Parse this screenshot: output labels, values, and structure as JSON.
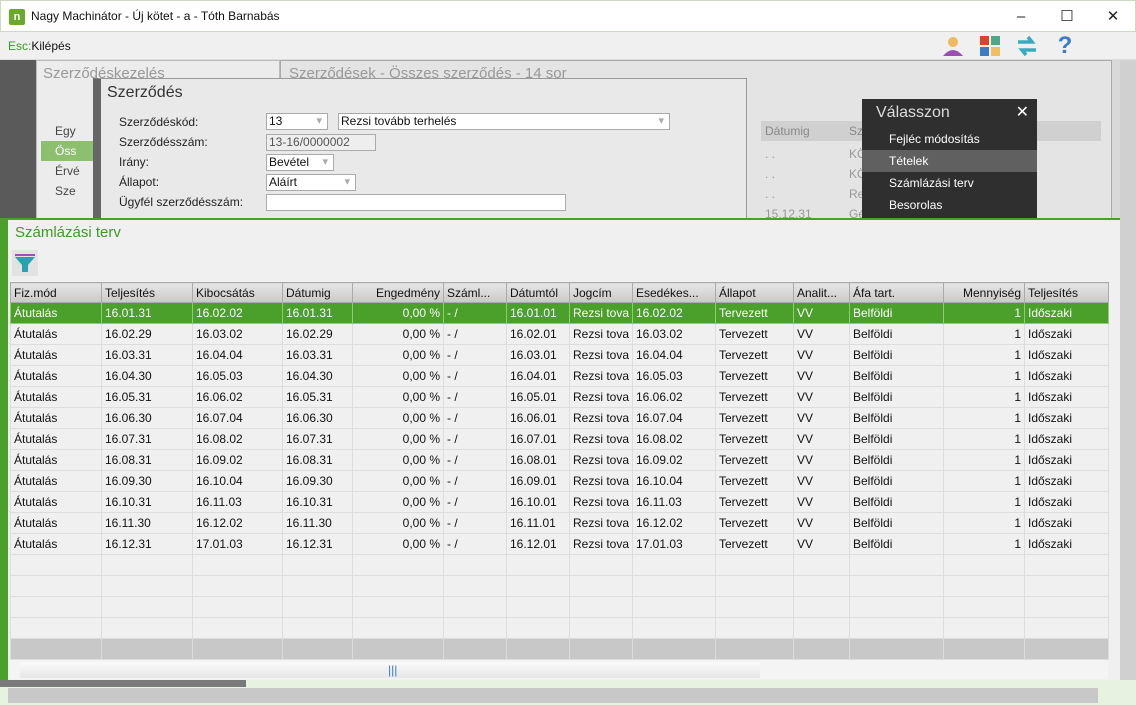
{
  "window": {
    "title": "Nagy Machinátor - Új kötet - a - Tóth Barnabás",
    "logo": "n",
    "minimize": "–",
    "maximize": "☐",
    "close": "✕"
  },
  "toolbar": {
    "esc_key": "Esc:",
    "esc_label": "Kilépés",
    "icons": [
      "user-icon",
      "apps-icon",
      "switch-icon",
      "help-icon"
    ],
    "help": "?"
  },
  "left_panel": {
    "title": "Szerződéskezelés",
    "items": [
      "Egy",
      "Öss",
      "Érvé",
      "Sze"
    ]
  },
  "list_panel": {
    "title": "Szerződések - Összes szerződés - 14 sor",
    "columns": [
      "Dátumig",
      "Sz"
    ],
    "rows": [
      [
        ". .",
        "KÖ"
      ],
      [
        ". .",
        "KÖ"
      ],
      [
        ". .",
        "Re"
      ],
      [
        "15.12.31",
        "Gé"
      ]
    ]
  },
  "dialog": {
    "title": "Szerződés",
    "fields": [
      {
        "label": "Szerződéskód:",
        "value": "13",
        "value2": "Rezsi tovább terhelés"
      },
      {
        "label": "Szerződésszám:",
        "value": "13-16/0000002"
      },
      {
        "label": "Irány:",
        "value": "Bevétel"
      },
      {
        "label": "Állapot:",
        "value": "Aláírt"
      },
      {
        "label": "Ügyfél szerződésszám:",
        "value": ""
      }
    ]
  },
  "menu": {
    "title": "Válasszon",
    "close": "✕",
    "items": [
      "Fejléc módosítás",
      "Tételek",
      "Számlázási terv",
      "Besorolas"
    ],
    "selected": 1
  },
  "billing": {
    "title": "Számlázási terv",
    "columns": [
      "Fiz.mód",
      "Teljesítés",
      "Kibocsátás",
      "Dátumig",
      "Engedmény",
      "Száml...",
      "Dátumtól",
      "Jogcím",
      "Esedékes...",
      "Állapot",
      "Analit...",
      "Áfa tart.",
      "Mennyiség",
      "Teljesítés"
    ],
    "rows": [
      [
        "Átutalás",
        "16.01.31",
        "16.02.02",
        "16.01.31",
        "0,00 %",
        "- /",
        "16.01.01",
        "Rezsi tova",
        "16.02.02",
        "Tervezett",
        "VV",
        "Belföldi",
        "1",
        "Időszaki"
      ],
      [
        "Átutalás",
        "16.02.29",
        "16.03.02",
        "16.02.29",
        "0,00 %",
        "- /",
        "16.02.01",
        "Rezsi tova",
        "16.03.02",
        "Tervezett",
        "VV",
        "Belföldi",
        "1",
        "Időszaki"
      ],
      [
        "Átutalás",
        "16.03.31",
        "16.04.04",
        "16.03.31",
        "0,00 %",
        "- /",
        "16.03.01",
        "Rezsi tova",
        "16.04.04",
        "Tervezett",
        "VV",
        "Belföldi",
        "1",
        "Időszaki"
      ],
      [
        "Átutalás",
        "16.04.30",
        "16.05.03",
        "16.04.30",
        "0,00 %",
        "- /",
        "16.04.01",
        "Rezsi tova",
        "16.05.03",
        "Tervezett",
        "VV",
        "Belföldi",
        "1",
        "Időszaki"
      ],
      [
        "Átutalás",
        "16.05.31",
        "16.06.02",
        "16.05.31",
        "0,00 %",
        "- /",
        "16.05.01",
        "Rezsi tova",
        "16.06.02",
        "Tervezett",
        "VV",
        "Belföldi",
        "1",
        "Időszaki"
      ],
      [
        "Átutalás",
        "16.06.30",
        "16.07.04",
        "16.06.30",
        "0,00 %",
        "- /",
        "16.06.01",
        "Rezsi tova",
        "16.07.04",
        "Tervezett",
        "VV",
        "Belföldi",
        "1",
        "Időszaki"
      ],
      [
        "Átutalás",
        "16.07.31",
        "16.08.02",
        "16.07.31",
        "0,00 %",
        "- /",
        "16.07.01",
        "Rezsi tova",
        "16.08.02",
        "Tervezett",
        "VV",
        "Belföldi",
        "1",
        "Időszaki"
      ],
      [
        "Átutalás",
        "16.08.31",
        "16.09.02",
        "16.08.31",
        "0,00 %",
        "- /",
        "16.08.01",
        "Rezsi tova",
        "16.09.02",
        "Tervezett",
        "VV",
        "Belföldi",
        "1",
        "Időszaki"
      ],
      [
        "Átutalás",
        "16.09.30",
        "16.10.04",
        "16.09.30",
        "0,00 %",
        "- /",
        "16.09.01",
        "Rezsi tova",
        "16.10.04",
        "Tervezett",
        "VV",
        "Belföldi",
        "1",
        "Időszaki"
      ],
      [
        "Átutalás",
        "16.10.31",
        "16.11.03",
        "16.10.31",
        "0,00 %",
        "- /",
        "16.10.01",
        "Rezsi tova",
        "16.11.03",
        "Tervezett",
        "VV",
        "Belföldi",
        "1",
        "Időszaki"
      ],
      [
        "Átutalás",
        "16.11.30",
        "16.12.02",
        "16.11.30",
        "0,00 %",
        "- /",
        "16.11.01",
        "Rezsi tova",
        "16.12.02",
        "Tervezett",
        "VV",
        "Belföldi",
        "1",
        "Időszaki"
      ],
      [
        "Átutalás",
        "16.12.31",
        "17.01.03",
        "16.12.31",
        "0,00 %",
        "- /",
        "16.12.01",
        "Rezsi tova",
        "17.01.03",
        "Tervezett",
        "VV",
        "Belföldi",
        "1",
        "Időszaki"
      ]
    ],
    "selected_row": 0,
    "scroll_grip": "|||"
  },
  "colors": {
    "accent": "#4aa02a",
    "menu_bg": "#2f2f2f"
  }
}
